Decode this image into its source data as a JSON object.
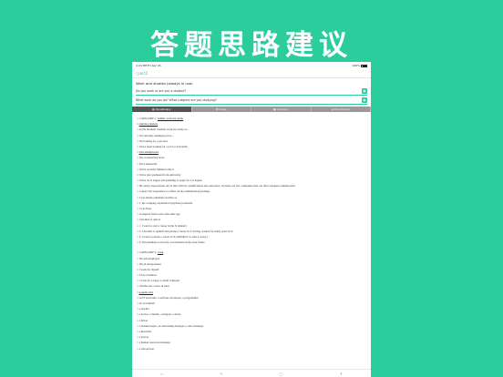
{
  "hero_title": "答题思路建议",
  "statusbar": {
    "left": "4:24 PM   Fri Apr 16",
    "right": "100%"
  },
  "navbar": {
    "back_label": "part1"
  },
  "section_title": "Work and studies (always in use)",
  "questions": [
    {
      "text": "Do you work or are you a student?"
    },
    {
      "text": "What work do you do? What subjects are you studying?"
    }
  ],
  "tabs": [
    {
      "label": "Vocabulary",
      "icon": "book-icon",
      "active": true
    },
    {
      "label": "Ideas",
      "icon": "bulb-icon",
      "active": false
    },
    {
      "label": "Answers",
      "icon": "chat-icon",
      "active": false
    },
    {
      "label": "Bookmarks",
      "icon": "bookmark-icon",
      "active": false
    }
  ],
  "list_items": [
    {
      "prefix": "○ ",
      "text": "CATEGORY 1: ",
      "underline": "neither work nor study",
      "type": "cat"
    },
    {
      "prefix": "○ ",
      "text": "",
      "underline": "entrance matters",
      "type": "item"
    },
    {
      "prefix": "○ ",
      "text": "At the moment I neither work nor study as...",
      "underline": "",
      "type": "item"
    },
    {
      "prefix": "○ ",
      "text": "I'm currently unemployed as...",
      "underline": "",
      "type": "item"
    },
    {
      "prefix": "○ ",
      "text": "I'm looking for a job now",
      "underline": "",
      "type": "item"
    },
    {
      "prefix": "○ ",
      "text": "I have been looking for a job for X months",
      "underline": "",
      "type": "item"
    },
    {
      "prefix": "○ ",
      "text": "",
      "underline": "jobs unemployed",
      "type": "item"
    },
    {
      "prefix": "○ ",
      "text": "I'm on maternity leave",
      "underline": "",
      "type": "item"
    },
    {
      "prefix": "○ ",
      "text": "I'm a housewife",
      "underline": "",
      "type": "item"
    },
    {
      "prefix": "○ ",
      "text": "I have recently finished school",
      "underline": "",
      "type": "item"
    },
    {
      "prefix": "○ ",
      "text": "I have just graduated from university",
      "underline": "",
      "type": "item"
    },
    {
      "prefix": "○ ",
      "text": "I have an X degree and planning to apply for a Z degree",
      "underline": "",
      "type": "item"
    },
    {
      "prefix": "○ ",
      "text": "My salary expectations are in line with my qualifications and education, but there are few companies that can offer adequate remuneration",
      "underline": "",
      "type": "item"
    },
    {
      "prefix": "○ ",
      "text": "I expect my experience to reflect on my remuneration package",
      "underline": "",
      "type": "item"
    },
    {
      "prefix": "○ ",
      "text": "I was made redundant recently as",
      "underline": "",
      "type": "item"
    },
    {
      "prefix": "○ ",
      "text": "1. the company experienced payment problems",
      "underline": "",
      "type": "item"
    },
    {
      "prefix": "○ ",
      "text": "I was fired",
      "underline": "",
      "type": "item"
    },
    {
      "prefix": "○ ",
      "text": "I resigned from work some time ago",
      "underline": "",
      "type": "item"
    },
    {
      "prefix": "○ ",
      "text": "I decided to quit as",
      "underline": "",
      "type": "item"
    },
    {
      "prefix": "○ ",
      "text": "1. I want to start a career in the X industry",
      "underline": "",
      "type": "item"
    },
    {
      "prefix": "○ ",
      "text": "2. I decided to upskill and pursue a career in Z, having worked for many years in X",
      "underline": "",
      "type": "item"
    },
    {
      "prefix": "○ ",
      "text": "3. I want to pursue a career in X (definition 'to start a career)",
      "underline": "",
      "type": "item"
    },
    {
      "prefix": "○ ",
      "text": "4. I'm planning to start my own business in the near future",
      "underline": "",
      "type": "item"
    },
    {
      "prefix": "",
      "text": "",
      "underline": "",
      "type": "gap"
    },
    {
      "prefix": "○ ",
      "text": "CATEGORY 2: ",
      "underline": "work",
      "type": "cat"
    },
    {
      "prefix": "○ ",
      "text": "I'm self-employed",
      "underline": "",
      "type": "item"
    },
    {
      "prefix": "○ ",
      "text": "I'm an entrepreneur",
      "underline": "",
      "type": "item"
    },
    {
      "prefix": "○ ",
      "text": "I work for myself",
      "underline": "",
      "type": "item"
    },
    {
      "prefix": "○ ",
      "text": "I run a business",
      "underline": "",
      "type": "item"
    },
    {
      "prefix": "○ ",
      "text": "I work for a large or small company",
      "underline": "",
      "type": "item"
    },
    {
      "prefix": "○ ",
      "text": "I further my career in sales",
      "underline": "",
      "type": "item"
    },
    {
      "prefix": "○ ",
      "text": "",
      "underline": "popular jobs",
      "type": "item"
    },
    {
      "prefix": "○ ",
      "text": "an IT specialist, a software developer, a programmer",
      "underline": "",
      "type": "item"
    },
    {
      "prefix": "○ ",
      "text": "an accountant",
      "underline": "",
      "type": "item"
    },
    {
      "prefix": "○ ",
      "text": "a teacher",
      "underline": "",
      "type": "item"
    },
    {
      "prefix": "○ ",
      "text": "a doctor, a dentist, a surgeon, a nurse",
      "underline": "",
      "type": "item"
    },
    {
      "prefix": "○ ",
      "text": "a driver",
      "underline": "",
      "type": "item"
    },
    {
      "prefix": "○ ",
      "text": "a marketologist, an advertising manager, a sales manager",
      "underline": "",
      "type": "item"
    },
    {
      "prefix": "○ ",
      "text": "a musician",
      "underline": "",
      "type": "item"
    },
    {
      "prefix": "○ ",
      "text": "a lawyer",
      "underline": "",
      "type": "item"
    },
    {
      "prefix": "○ ",
      "text": "a human resources manager",
      "underline": "",
      "type": "item"
    },
    {
      "prefix": "○ ",
      "text": "a salesperson",
      "underline": "",
      "type": "item"
    }
  ],
  "toolbar": [
    {
      "icon": "list-icon",
      "glyph": "≡"
    },
    {
      "icon": "edit-icon",
      "glyph": "✎"
    },
    {
      "icon": "mic-icon",
      "glyph": "◯"
    },
    {
      "icon": "share-icon",
      "glyph": "⬆"
    }
  ]
}
